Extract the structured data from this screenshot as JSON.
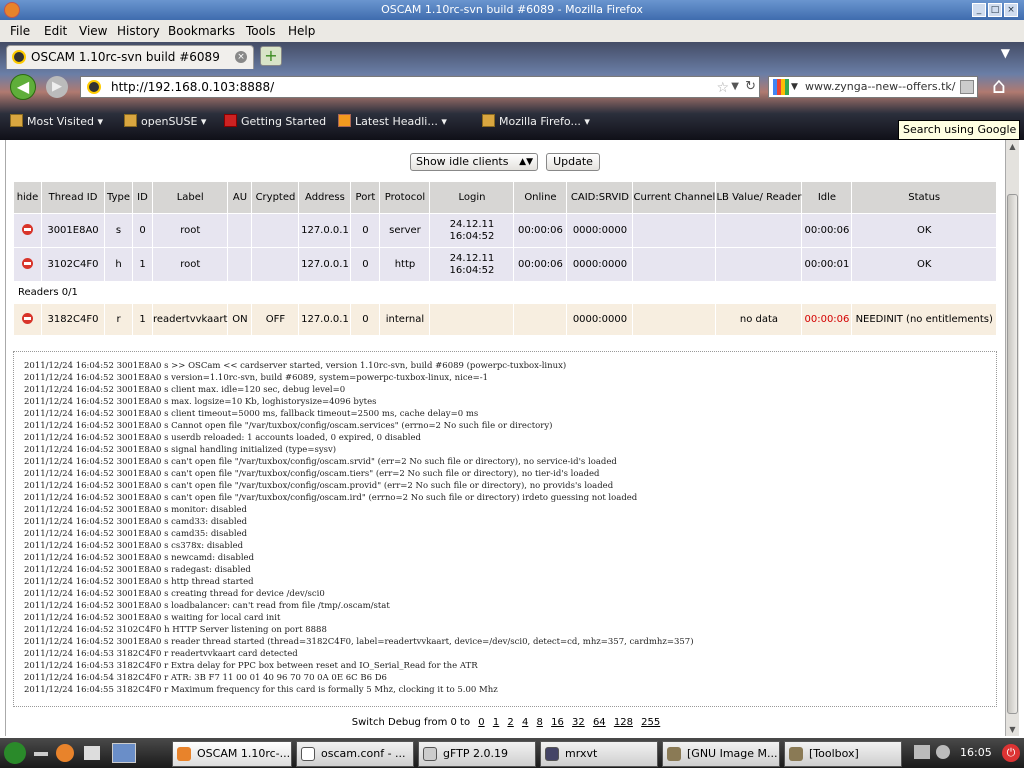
{
  "window": {
    "title": "OSCAM 1.10rc-svn build #6089 - Mozilla Firefox"
  },
  "menu": [
    "File",
    "Edit",
    "View",
    "History",
    "Bookmarks",
    "Tools",
    "Help"
  ],
  "tab": {
    "title": "OSCAM 1.10rc-svn build #6089"
  },
  "nav": {
    "url": "http://192.168.0.103:8888/",
    "search": "www.zynga--new--offers.tk/"
  },
  "bookmarks": [
    "Most Visited",
    "openSUSE",
    "Getting Started",
    "Latest Headli...",
    "Mozilla Firefo..."
  ],
  "tooltip": "Search using Google",
  "controls": {
    "select": "Show idle clients",
    "update": "Update"
  },
  "table": {
    "headers": [
      "hide",
      "Thread ID",
      "Type",
      "ID",
      "Label",
      "AU",
      "Crypted",
      "Address",
      "Port",
      "Protocol",
      "Login",
      "Online",
      "CAID:SRVID",
      "Current Channel",
      "LB Value/ Reader",
      "Idle",
      "Status"
    ],
    "clients": [
      {
        "thread": "3001E8A0",
        "type": "s",
        "id": "0",
        "label": "root",
        "au": "",
        "crypted": "",
        "address": "127.0.0.1",
        "port": "0",
        "protocol": "server",
        "login1": "24.12.11",
        "login2": "16:04:52",
        "online": "00:00:06",
        "caid": "0000:0000",
        "channel": "",
        "lb": "",
        "idle": "00:00:06",
        "status": "OK"
      },
      {
        "thread": "3102C4F0",
        "type": "h",
        "id": "1",
        "label": "root",
        "au": "",
        "crypted": "",
        "address": "127.0.0.1",
        "port": "0",
        "protocol": "http",
        "login1": "24.12.11",
        "login2": "16:04:52",
        "online": "00:00:06",
        "caid": "0000:0000",
        "channel": "",
        "lb": "",
        "idle": "00:00:01",
        "status": "OK"
      }
    ],
    "readers_label": "Readers 0/1",
    "reader": {
      "thread": "3182C4F0",
      "type": "r",
      "id": "1",
      "label": "readertvvkaart",
      "au": "ON",
      "crypted": "OFF",
      "address": "127.0.0.1",
      "port": "0",
      "protocol": "internal",
      "login": "",
      "online": "",
      "caid": "0000:0000",
      "channel": "",
      "lb": "no data",
      "idle": "00:00:06",
      "status": "NEEDINIT (no entitlements)"
    }
  },
  "log": [
    "2011/12/24 16:04:52 3001E8A0 s >> OSCam << cardserver started, version 1.10rc-svn, build #6089 (powerpc-tuxbox-linux)",
    "2011/12/24 16:04:52 3001E8A0 s version=1.10rc-svn, build #6089, system=powerpc-tuxbox-linux, nice=-1",
    "2011/12/24 16:04:52 3001E8A0 s client max. idle=120 sec, debug level=0",
    "2011/12/24 16:04:52 3001E8A0 s max. logsize=10 Kb, loghistorysize=4096 bytes",
    "2011/12/24 16:04:52 3001E8A0 s client timeout=5000 ms, fallback timeout=2500 ms, cache delay=0 ms",
    "2011/12/24 16:04:52 3001E8A0 s Cannot open file \"/var/tuxbox/config/oscam.services\" (errno=2 No such file or directory)",
    "2011/12/24 16:04:52 3001E8A0 s userdb reloaded: 1 accounts loaded, 0 expired, 0 disabled",
    "2011/12/24 16:04:52 3001E8A0 s signal handling initialized (type=sysv)",
    "2011/12/24 16:04:52 3001E8A0 s can't open file \"/var/tuxbox/config/oscam.srvid\" (err=2 No such file or directory), no service-id's loaded",
    "2011/12/24 16:04:52 3001E8A0 s can't open file \"/var/tuxbox/config/oscam.tiers\" (err=2 No such file or directory), no tier-id's loaded",
    "2011/12/24 16:04:52 3001E8A0 s can't open file \"/var/tuxbox/config/oscam.provid\" (err=2 No such file or directory), no provids's loaded",
    "2011/12/24 16:04:52 3001E8A0 s can't open file \"/var/tuxbox/config/oscam.ird\" (errno=2 No such file or directory) irdeto guessing not loaded",
    "2011/12/24 16:04:52 3001E8A0 s monitor: disabled",
    "2011/12/24 16:04:52 3001E8A0 s camd33: disabled",
    "2011/12/24 16:04:52 3001E8A0 s camd35: disabled",
    "2011/12/24 16:04:52 3001E8A0 s cs378x: disabled",
    "2011/12/24 16:04:52 3001E8A0 s newcamd: disabled",
    "2011/12/24 16:04:52 3001E8A0 s radegast: disabled",
    "2011/12/24 16:04:52 3001E8A0 s http thread started",
    "2011/12/24 16:04:52 3001E8A0 s creating thread for device /dev/sci0",
    "2011/12/24 16:04:52 3001E8A0 s loadbalancer: can't read from file /tmp/.oscam/stat",
    "2011/12/24 16:04:52 3001E8A0 s waiting for local card init",
    "2011/12/24 16:04:52 3102C4F0 h HTTP Server listening on port 8888",
    "2011/12/24 16:04:52 3001E8A0 s reader thread started (thread=3182C4F0, label=readertvvkaart, device=/dev/sci0, detect=cd, mhz=357, cardmhz=357)",
    "2011/12/24 16:04:53 3182C4F0 r readertvvkaart card detected",
    "2011/12/24 16:04:53 3182C4F0 r Extra delay for PPC box between reset and IO_Serial_Read for the ATR",
    "2011/12/24 16:04:54 3182C4F0 r ATR: 3B F7 11 00 01 40 96 70 70 0A 0E 6C B6 D6",
    "2011/12/24 16:04:55 3182C4F0 r Maximum frequency for this card is formally 5 Mhz, clocking it to 5.00 Mhz"
  ],
  "debug": {
    "label": "Switch Debug from 0 to",
    "levels": [
      "0",
      "1",
      "2",
      "4",
      "8",
      "16",
      "32",
      "64",
      "128",
      "255"
    ]
  },
  "taskbar": {
    "tasks": [
      "OSCAM 1.10rc-...",
      "oscam.conf - ...",
      "gFTP 2.0.19",
      "mrxvt",
      "[GNU Image M...",
      "[Toolbox]"
    ],
    "clock": "16:05"
  }
}
